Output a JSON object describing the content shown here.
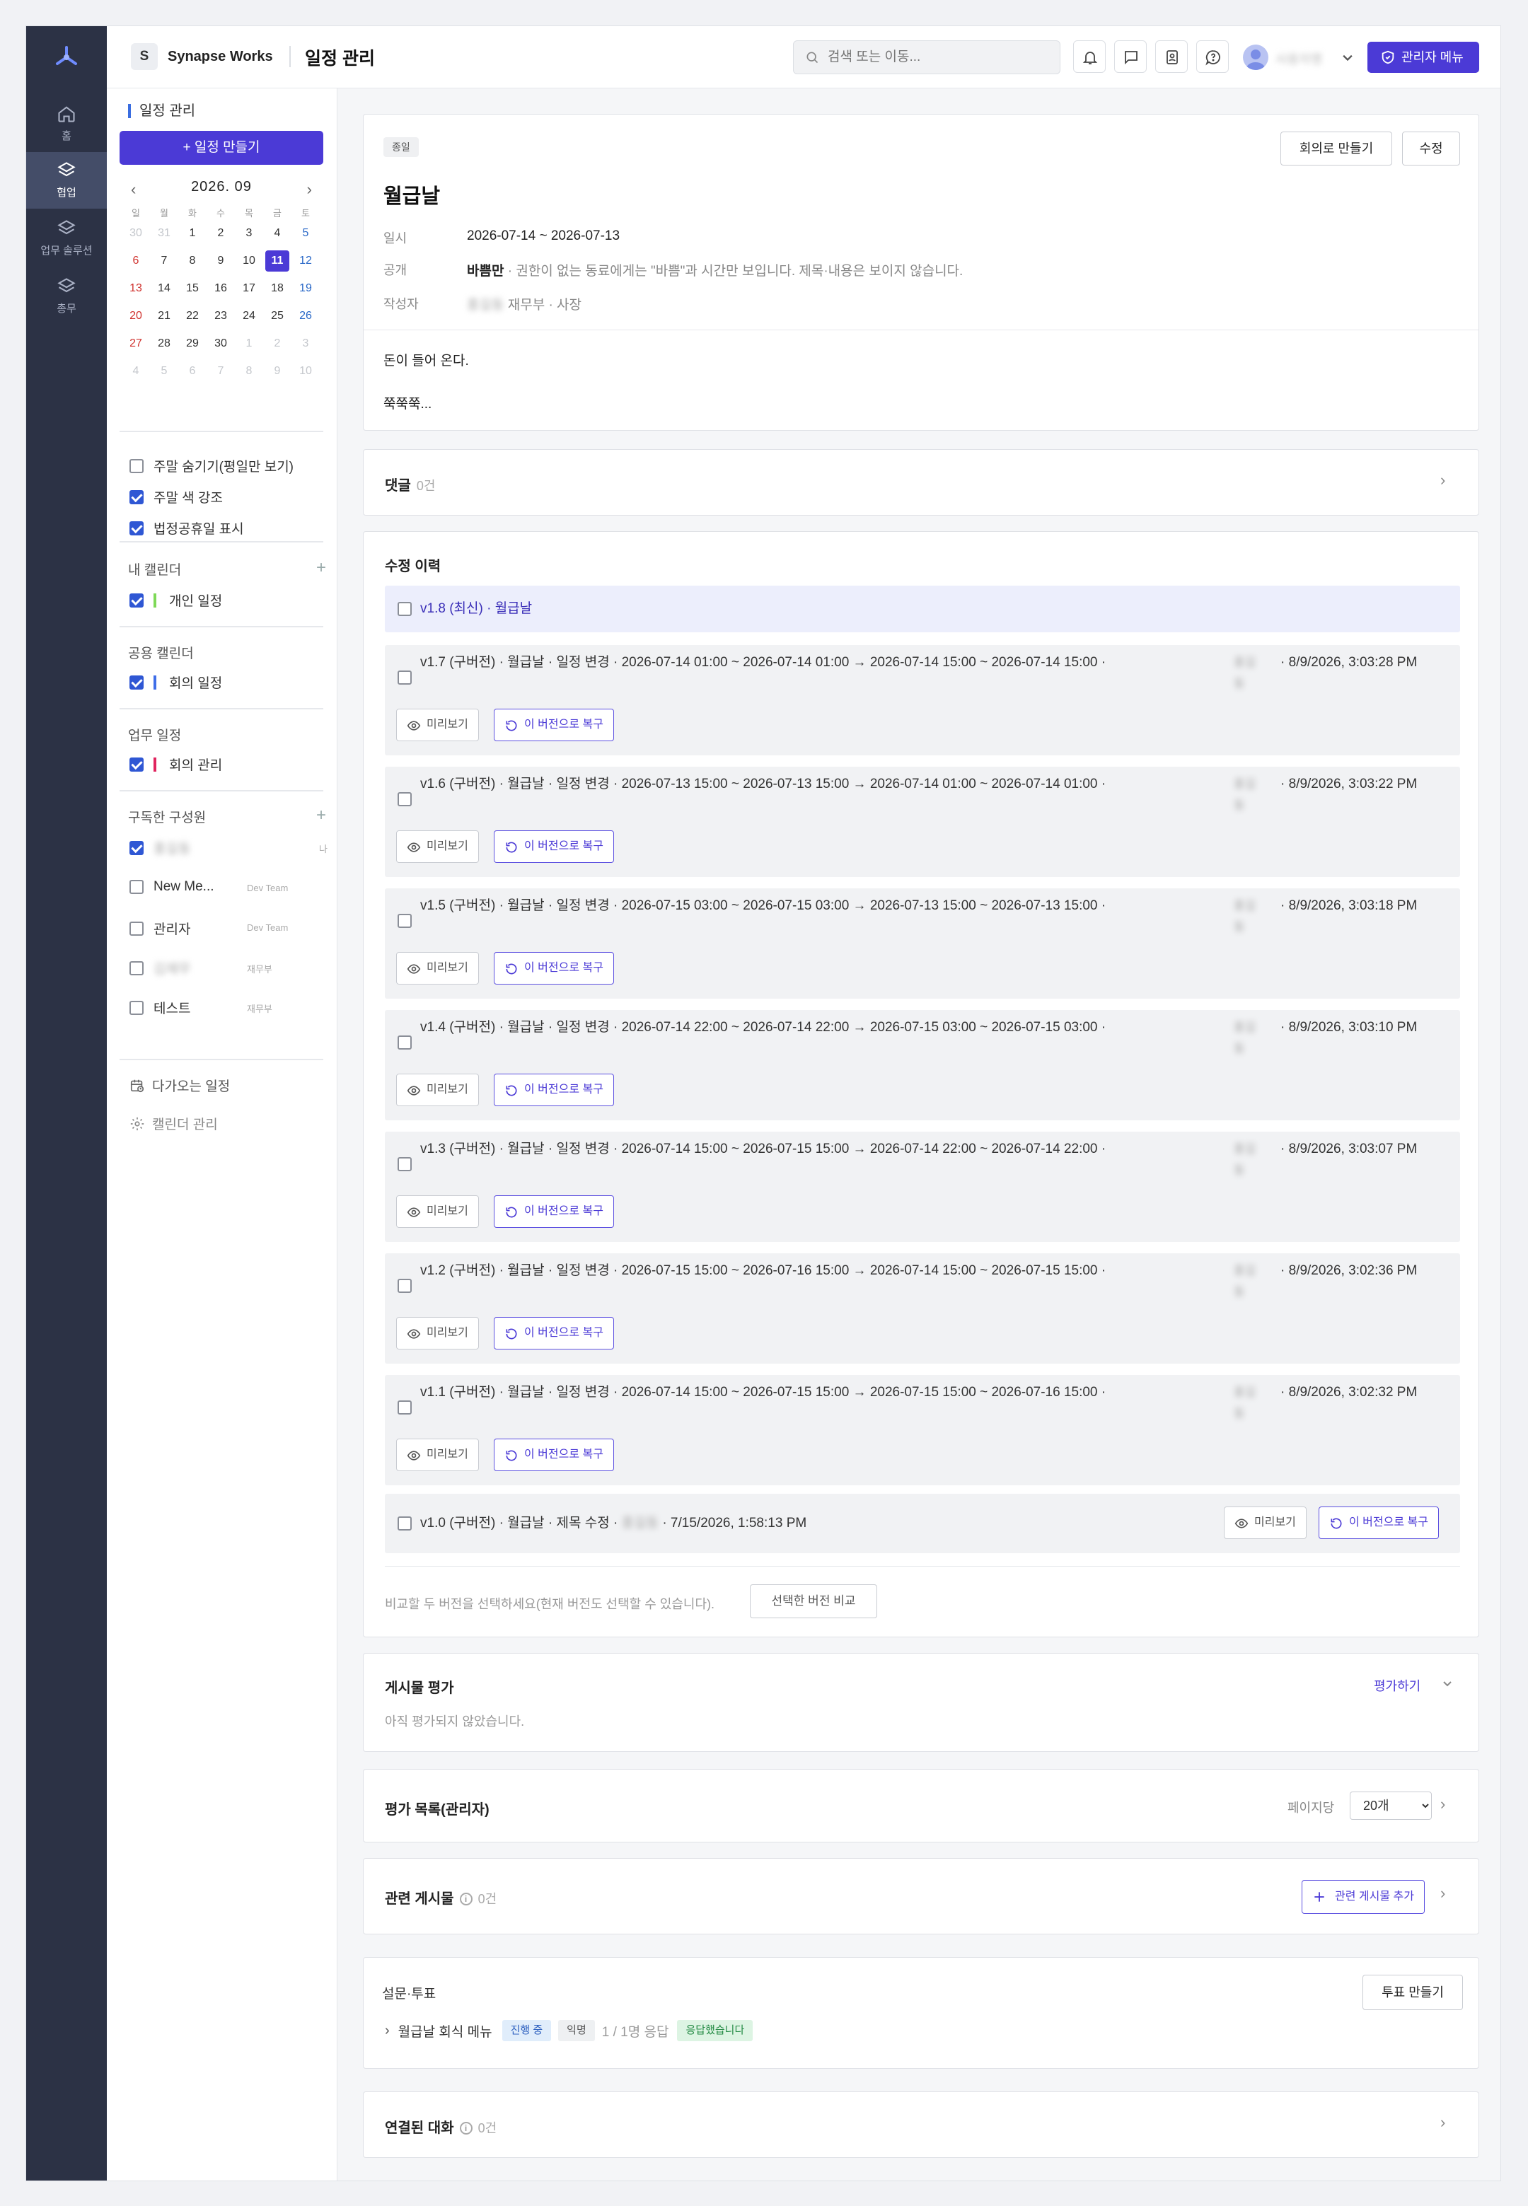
{
  "rail": {
    "items": [
      {
        "label": "홈",
        "icon": "home-icon"
      },
      {
        "label": "협업",
        "icon": "layers-icon"
      },
      {
        "label": "업무 솔루션",
        "icon": "layers-icon"
      },
      {
        "label": "총무",
        "icon": "layers-icon"
      }
    ]
  },
  "topbar": {
    "workspace_badge": "S",
    "workspace_name": "Synapse Works",
    "page_title": "일정 관리",
    "search_placeholder": "검색 또는 이동...",
    "user_name": "사용자명",
    "admin_label": "관리자 메뉴"
  },
  "left": {
    "section_title": "일정 관리",
    "new_button": "+ 일정 만들기",
    "calendar": {
      "month_label": "2026. 09",
      "dow": [
        "일",
        "월",
        "화",
        "수",
        "목",
        "금",
        "토"
      ],
      "weeks": [
        [
          "30",
          "31",
          "1",
          "2",
          "3",
          "4",
          "5"
        ],
        [
          "6",
          "7",
          "8",
          "9",
          "10",
          "11",
          "12"
        ],
        [
          "13",
          "14",
          "15",
          "16",
          "17",
          "18",
          "19"
        ],
        [
          "20",
          "21",
          "22",
          "23",
          "24",
          "25",
          "26"
        ],
        [
          "27",
          "28",
          "29",
          "30",
          "1",
          "2",
          "3"
        ],
        [
          "4",
          "5",
          "6",
          "7",
          "8",
          "9",
          "10"
        ]
      ],
      "today": "11"
    },
    "options": [
      {
        "label": "주말 숨기기(평일만 보기)",
        "checked": false
      },
      {
        "label": "주말 색 강조",
        "checked": true
      },
      {
        "label": "법정공휴일 표시",
        "checked": true
      }
    ],
    "my_calendars_title": "내 캘린더",
    "my_calendars": [
      {
        "label": "개인 일정",
        "color": "#7ed957"
      }
    ],
    "shared_title": "공용 캘린더",
    "shared": [
      {
        "label": "회의 일정",
        "color": "#3f6ee8"
      }
    ],
    "work_title": "업무 일정",
    "work": [
      {
        "label": "회의 관리",
        "color": "#e0245e"
      }
    ],
    "members_title": "구독한 구성원",
    "members": [
      {
        "name": "홍길동",
        "team": "나",
        "checked": true,
        "blurred": true
      },
      {
        "name": "New Me...",
        "team": "Dev Team",
        "checked": false,
        "blurred": false
      },
      {
        "name": "관리자",
        "team": "Dev Team",
        "checked": false,
        "blurred": false
      },
      {
        "name": "김재무",
        "team": "재무부",
        "checked": false,
        "blurred": true
      },
      {
        "name": "테스트",
        "team": "재무부",
        "checked": false,
        "blurred": false
      }
    ],
    "upcoming_label": "다가오는 일정",
    "manage_label": "캘린더 관리"
  },
  "event": {
    "tag": "종일",
    "meeting_button": "회의로 만들기",
    "edit_button": "수정",
    "title": "월급날",
    "date_label": "일시",
    "date_value": "2026-07-14 ~ 2026-07-13",
    "visibility_label": "공개",
    "visibility_strong": "바쁨만",
    "visibility_note": " · 권한이 없는 동료에게는 \"바쁨\"과 시간만 보입니다. 제목·내용은 보이지 않습니다.",
    "author_label": "작성자",
    "author_name": "홍길동",
    "author_dept": "재무부 · 사장",
    "body_line1": "돈이 들어 온다.",
    "body_line2": "쭉쭉쭉..."
  },
  "comments": {
    "title": "댓글",
    "count": "0건"
  },
  "history": {
    "title": "수정 이력",
    "latest": "v1.8 (최신) · 월급날",
    "versions": [
      {
        "text": "v1.7 (구버전) · 월급날 · 일정 변경 · 2026-07-14 01:00 ~ 2026-07-14 01:00 → 2026-07-14 15:00 ~ 2026-07-14 15:00 ·",
        "author": "홍길동",
        "time": "· 8/9/2026, 3:03:28 PM"
      },
      {
        "text": "v1.6 (구버전) · 월급날 · 일정 변경 · 2026-07-13 15:00 ~ 2026-07-13 15:00 → 2026-07-14 01:00 ~ 2026-07-14 01:00 ·",
        "author": "홍길동",
        "time": "· 8/9/2026, 3:03:22 PM"
      },
      {
        "text": "v1.5 (구버전) · 월급날 · 일정 변경 · 2026-07-15 03:00 ~ 2026-07-15 03:00 → 2026-07-13 15:00 ~ 2026-07-13 15:00 ·",
        "author": "홍길동",
        "time": "· 8/9/2026, 3:03:18 PM"
      },
      {
        "text": "v1.4 (구버전) · 월급날 · 일정 변경 · 2026-07-14 22:00 ~ 2026-07-14 22:00 → 2026-07-15 03:00 ~ 2026-07-15 03:00 ·",
        "author": "홍길동",
        "time": "· 8/9/2026, 3:03:10 PM"
      },
      {
        "text": "v1.3 (구버전) · 월급날 · 일정 변경 · 2026-07-14 15:00 ~ 2026-07-15 15:00 → 2026-07-14 22:00 ~ 2026-07-14 22:00 ·",
        "author": "홍길동",
        "time": "· 8/9/2026, 3:03:07 PM"
      },
      {
        "text": "v1.2 (구버전) · 월급날 · 일정 변경 · 2026-07-15 15:00 ~ 2026-07-16 15:00 → 2026-07-14 15:00 ~ 2026-07-15 15:00 ·",
        "author": "홍길동",
        "time": "· 8/9/2026, 3:02:36 PM"
      },
      {
        "text": "v1.1 (구버전) · 월급날 · 일정 변경 · 2026-07-14 15:00 ~ 2026-07-15 15:00 → 2026-07-15 15:00 ~ 2026-07-16 15:00 ·",
        "author": "홍길동",
        "time": "· 8/9/2026, 3:02:32 PM"
      }
    ],
    "v10_text": "v1.0 (구버전) · 월급날 · 제목 수정 ·",
    "v10_author": "홍길동",
    "v10_time": "· 7/15/2026, 1:58:13 PM",
    "preview_label": "미리보기",
    "restore_label": "이 버전으로 복구",
    "compare_hint": "비교할 두 버전을 선택하세요(현재 버전도 선택할 수 있습니다).",
    "compare_button": "선택한 버전 비교"
  },
  "rating": {
    "title": "게시물 평가",
    "action": "평가하기",
    "empty": "아직 평가되지 않았습니다."
  },
  "rating_list": {
    "title": "평가 목록(관리자)",
    "per_page_label": "페이지당",
    "per_page_value": "20개"
  },
  "related": {
    "title": "관련 게시물",
    "count": "0건",
    "add_button": "관련 게시물 추가"
  },
  "survey": {
    "title": "설문·투표",
    "create_button": "투표 만들기",
    "item_title": "월급날 회식 메뉴",
    "status": "진행 중",
    "anon": "익명",
    "responses": "1 / 1명 응답",
    "responded": "응답했습니다"
  },
  "linked": {
    "title": "연결된 대화",
    "count": "0건"
  },
  "colors": {
    "accent": "#4b3ad6",
    "rail": "#2c3245",
    "sunday": "#d0332f",
    "saturday": "#2867c7"
  }
}
